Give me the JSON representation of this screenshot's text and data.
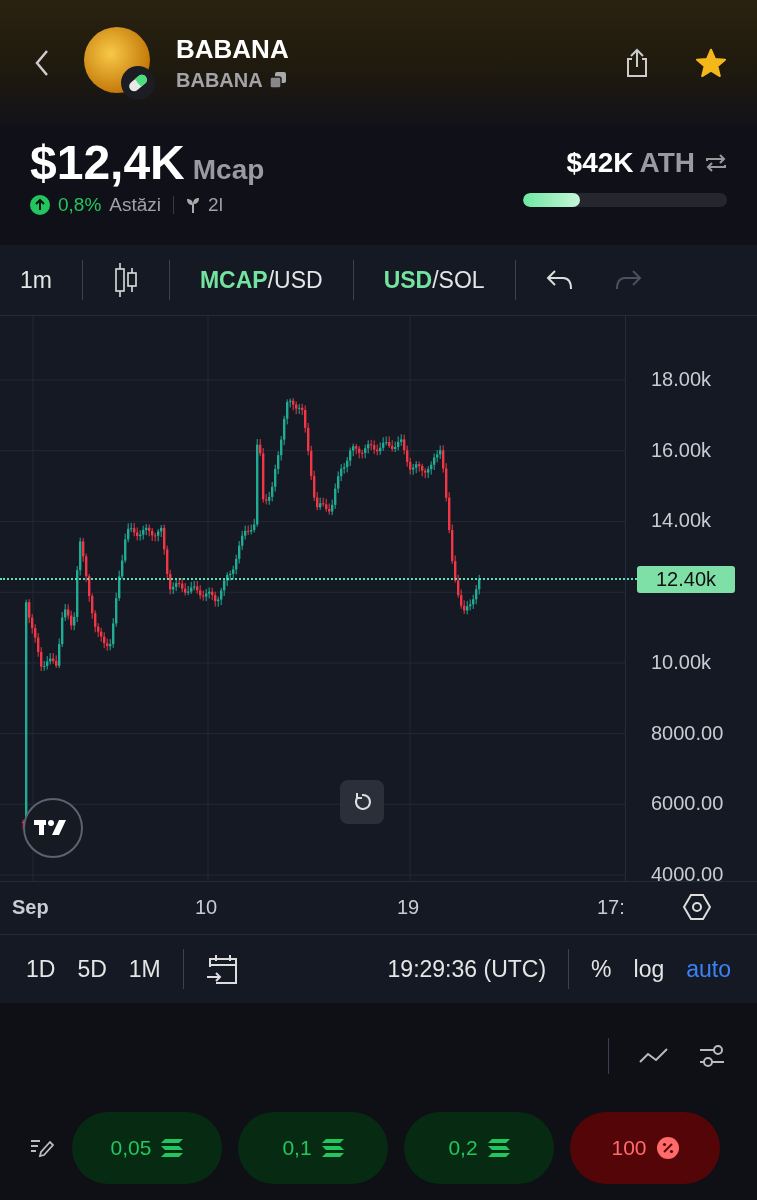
{
  "header": {
    "name": "BABANA",
    "ticker": "BABANA",
    "starred": true
  },
  "stats": {
    "mcap_value": "$12,4K",
    "mcap_label": "Mcap",
    "change": "0,8%",
    "change_period": "Astăzi",
    "age": "2l",
    "ath_value": "$42K",
    "ath_label": "ATH",
    "ath_progress": {
      "level": 0.28
    }
  },
  "toolbar": {
    "interval": "1m",
    "pairs": [
      {
        "base": "MCAP",
        "quote": "/USD"
      },
      {
        "base": "USD",
        "quote": "/SOL"
      }
    ],
    "history": [
      {
        "kind": "undo",
        "disabled": false
      },
      {
        "kind": "redo",
        "disabled": true
      }
    ]
  },
  "chart": {
    "y_labels": [
      "18.00k",
      "16.00k",
      "14.00k",
      "10.00k",
      "8000.00",
      "6000.00",
      "4000.00"
    ],
    "last_price": "12.40k",
    "x_labels": [
      "Sep",
      "10",
      "19",
      "17:"
    ]
  },
  "bottom_bar": {
    "ranges": [
      "1D",
      "5D",
      "1M"
    ],
    "time": "19:29:36 (UTC)",
    "scale_options": [
      {
        "label": "%",
        "selected": false
      },
      {
        "label": "log",
        "selected": false
      },
      {
        "label": "auto",
        "selected": true
      }
    ]
  },
  "quick_buys": [
    {
      "label": "0,05",
      "kind": "buy"
    },
    {
      "label": "0,1",
      "kind": "buy"
    },
    {
      "label": "0,2",
      "kind": "buy"
    },
    {
      "label": "100",
      "kind": "sell"
    }
  ]
}
